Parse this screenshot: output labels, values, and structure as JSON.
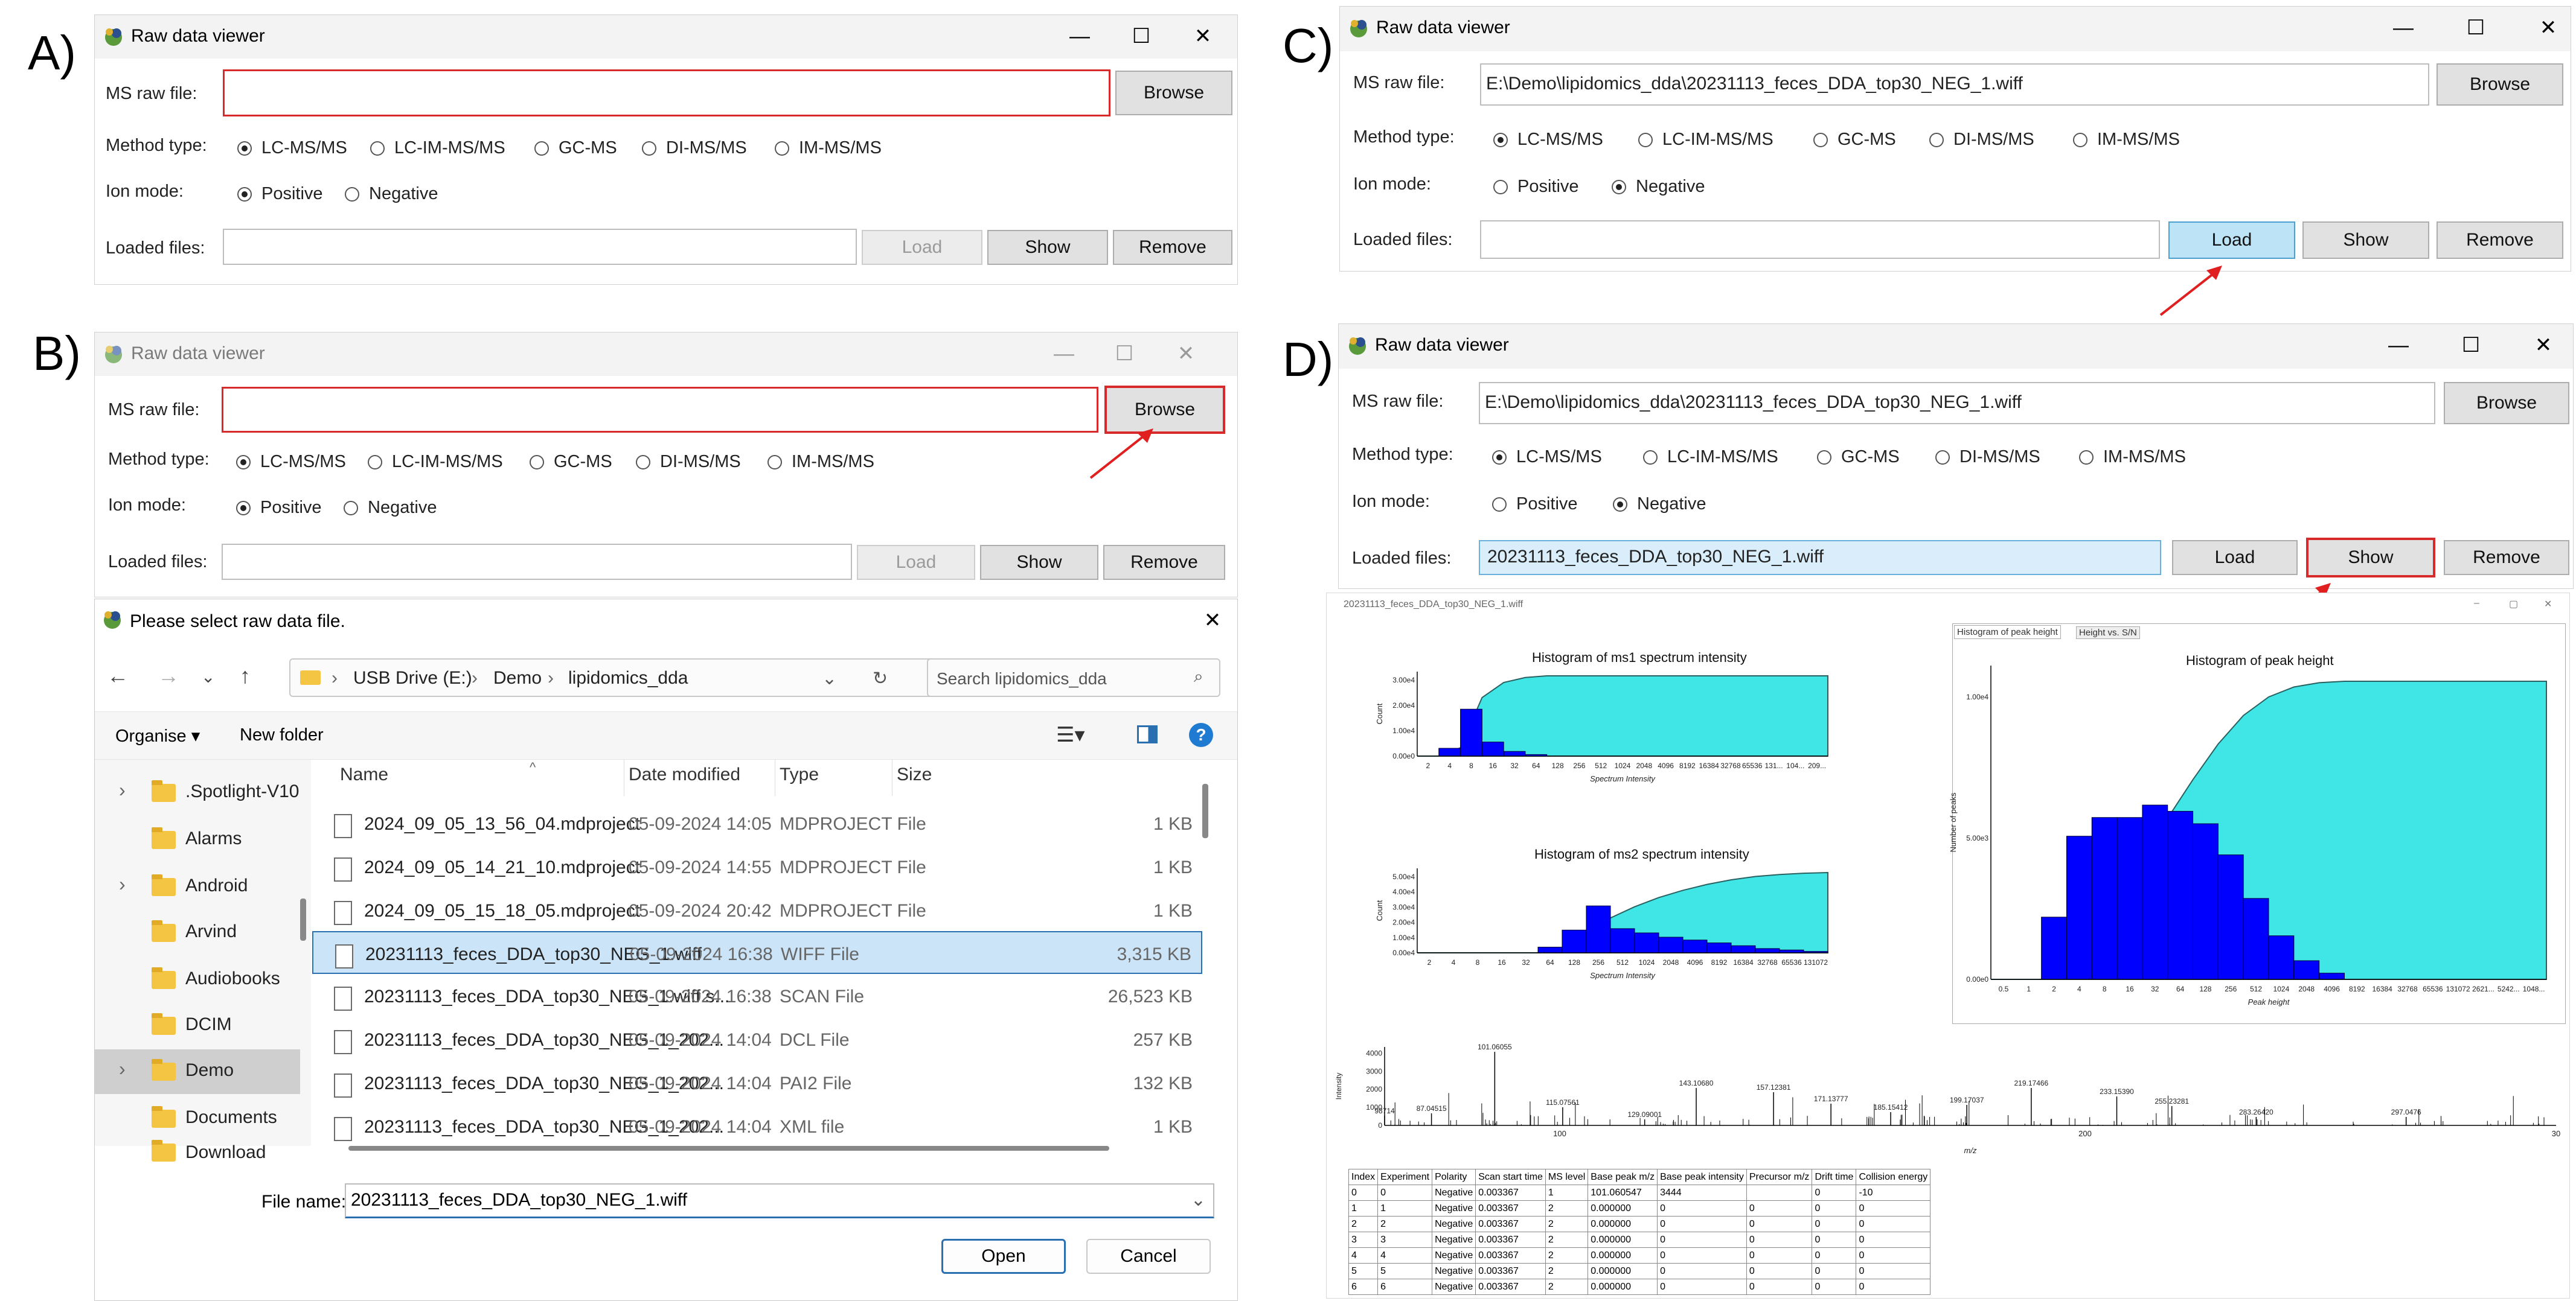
{
  "panel_labels": {
    "a": "A)",
    "b": "B)",
    "c": "C)",
    "d": "D)"
  },
  "app_title": "Raw data viewer",
  "labels": {
    "ms_raw_file": "MS raw file:",
    "method_type": "Method type:",
    "ion_mode": "Ion mode:",
    "loaded_files": "Loaded files:"
  },
  "buttons": {
    "browse": "Browse",
    "load": "Load",
    "show": "Show",
    "remove": "Remove"
  },
  "method_options": [
    "LC-MS/MS",
    "LC-IM-MS/MS",
    "GC-MS",
    "DI-MS/MS",
    "IM-MS/MS"
  ],
  "ion_options": [
    "Positive",
    "Negative"
  ],
  "panel_c": {
    "raw_path": "E:\\Demo\\lipidomics_dda\\20231113_feces_DDA_top30_NEG_1.wiff"
  },
  "panel_d": {
    "raw_path": "E:\\Demo\\lipidomics_dda\\20231113_feces_DDA_top30_NEG_1.wiff",
    "loaded_file": "20231113_feces_DDA_top30_NEG_1.wiff"
  },
  "dialog": {
    "title": "Please select raw data file.",
    "breadcrumb": [
      "USB Drive (E:)",
      "Demo",
      "lipidomics_dda"
    ],
    "search_placeholder": "Search lipidomics_dda",
    "organise": "Organise ▾",
    "new_folder": "New folder",
    "nav_items": [
      ".Spotlight-V10",
      "Alarms",
      "Android",
      "Arvind",
      "Audiobooks",
      "DCIM",
      "Demo",
      "Documents",
      "Download"
    ],
    "columns": [
      "Name",
      "Date modified",
      "Type",
      "Size"
    ],
    "files": [
      {
        "name": "2024_09_05_13_56_04.mdproject",
        "date": "05-09-2024 14:05",
        "type": "MDPROJECT File",
        "size": "1 KB"
      },
      {
        "name": "2024_09_05_14_21_10.mdproject",
        "date": "05-09-2024 14:55",
        "type": "MDPROJECT File",
        "size": "1 KB"
      },
      {
        "name": "2024_09_05_15_18_05.mdproject",
        "date": "05-09-2024 20:42",
        "type": "MDPROJECT File",
        "size": "1 KB"
      },
      {
        "name": "20231113_feces_DDA_top30_NEG_1.wiff",
        "date": "05-09-2024 16:38",
        "type": "WIFF File",
        "size": "3,315 KB"
      },
      {
        "name": "20231113_feces_DDA_top30_NEG_1.wiff.s...",
        "date": "05-09-2024 16:38",
        "type": "SCAN File",
        "size": "26,523 KB"
      },
      {
        "name": "20231113_feces_DDA_top30_NEG_1_202...",
        "date": "05-09-2024 14:04",
        "type": "DCL File",
        "size": "257 KB"
      },
      {
        "name": "20231113_feces_DDA_top30_NEG_1_202...",
        "date": "05-09-2024 14:04",
        "type": "PAI2 File",
        "size": "132 KB"
      },
      {
        "name": "20231113_feces_DDA_top30_NEG_1_202...",
        "date": "05-09-2024 14:04",
        "type": "XML file",
        "size": "1 KB"
      }
    ],
    "file_name_label": "File name:",
    "file_name_value": "20231113_feces_DDA_top30_NEG_1.wiff",
    "open": "Open",
    "cancel": "Cancel"
  },
  "plot_window": {
    "title": "20231113_feces_DDA_top30_NEG_1.wiff",
    "tabs": [
      "Histogram of peak height",
      "Height vs. S/N"
    ]
  },
  "chart_data": [
    {
      "type": "bar",
      "title": "Histogram of ms1 spectrum intensity",
      "xlabel": "Spectrum Intensity",
      "ylabel": "Count",
      "categories": [
        "2",
        "4",
        "8",
        "16",
        "32",
        "64",
        "128",
        "256",
        "512",
        "1024",
        "2048",
        "4096",
        "8192",
        "16384",
        "32768",
        "65536",
        "131...",
        "104...",
        "209..."
      ],
      "values": [
        0,
        0.25,
        1.5,
        0.45,
        0.15,
        0.05,
        0,
        0,
        0,
        0,
        0,
        0,
        0,
        0,
        0,
        0,
        0,
        0,
        0
      ],
      "yticks": [
        "0.00e0",
        "1.00e4",
        "2.00e4",
        "3.00e4"
      ],
      "cumulative": true,
      "bar_color": "#0000ff",
      "fill_color": "#40e5e5"
    },
    {
      "type": "bar",
      "title": "Histogram of ms2 spectrum intensity",
      "xlabel": "Spectrum Intensity",
      "ylabel": "Count",
      "categories": [
        "2",
        "4",
        "8",
        "16",
        "32",
        "64",
        "128",
        "256",
        "512",
        "1024",
        "2048",
        "4096",
        "8192",
        "16384",
        "32768",
        "65536",
        "131072"
      ],
      "values": [
        0,
        0,
        0,
        0,
        0,
        0.2,
        0.8,
        1.65,
        0.85,
        0.7,
        0.55,
        0.45,
        0.35,
        0.25,
        0.15,
        0.1,
        0.05
      ],
      "yticks": [
        "0.00e4",
        "1.00e4",
        "2.00e4",
        "3.00e4",
        "4.00e4",
        "5.00e4"
      ],
      "cumulative": true,
      "bar_color": "#0000ff",
      "fill_color": "#40e5e5"
    },
    {
      "type": "bar",
      "title": "Histogram of peak height",
      "xlabel": "Peak height",
      "ylabel": "Number of peaks",
      "categories": [
        "0.5",
        "1",
        "2",
        "4",
        "8",
        "16",
        "32",
        "64",
        "128",
        "256",
        "512",
        "1024",
        "2048",
        "4096",
        "8192",
        "16384",
        "32768",
        "65536",
        "131072",
        "2621...",
        "5242...",
        "1048..."
      ],
      "values": [
        0,
        0,
        0.1,
        0.23,
        0.26,
        0.26,
        0.28,
        0.27,
        0.25,
        0.2,
        0.13,
        0.07,
        0.03,
        0.01,
        0,
        0,
        0,
        0,
        0,
        0,
        0,
        0
      ],
      "yticks": [
        "0.00e0",
        "5.00e3",
        "1.00e4"
      ],
      "cumulative": true,
      "bar_color": "#0000ff",
      "fill_color": "#40e5e5"
    },
    {
      "type": "line",
      "title": "",
      "xlabel": "m/z",
      "ylabel": "Intensity",
      "yticks": [
        "0",
        "1000",
        "2000",
        "3000",
        "4000"
      ],
      "xticks": [
        "100",
        "200",
        "30"
      ],
      "peak_labels": [
        "98714",
        "87.04515",
        "101.06055",
        "115.07561",
        "129.09001",
        "143.10680",
        "157.12381",
        "171.13777",
        "185.15412",
        "199.17037",
        "219.17466",
        "233.15390",
        "255.23281",
        "283.26420",
        "297.0476"
      ]
    }
  ],
  "table": {
    "headers": [
      "Index",
      "Experiment",
      "Polarity",
      "Scan start time",
      "MS level",
      "Base peak m/z",
      "Base peak intensity",
      "Precursor m/z",
      "Drift time",
      "Collision energy"
    ],
    "rows": [
      [
        "0",
        "0",
        "Negative",
        "0.003367",
        "1",
        "101.060547",
        "3444",
        "",
        "0",
        "-10"
      ],
      [
        "1",
        "1",
        "Negative",
        "0.003367",
        "2",
        "0.000000",
        "0",
        "0",
        "0",
        "0"
      ],
      [
        "2",
        "2",
        "Negative",
        "0.003367",
        "2",
        "0.000000",
        "0",
        "0",
        "0",
        "0"
      ],
      [
        "3",
        "3",
        "Negative",
        "0.003367",
        "2",
        "0.000000",
        "0",
        "0",
        "0",
        "0"
      ],
      [
        "4",
        "4",
        "Negative",
        "0.003367",
        "2",
        "0.000000",
        "0",
        "0",
        "0",
        "0"
      ],
      [
        "5",
        "5",
        "Negative",
        "0.003367",
        "2",
        "0.000000",
        "0",
        "0",
        "0",
        "0"
      ],
      [
        "6",
        "6",
        "Negative",
        "0.003367",
        "2",
        "0.000000",
        "0",
        "0",
        "0",
        "0"
      ]
    ]
  }
}
